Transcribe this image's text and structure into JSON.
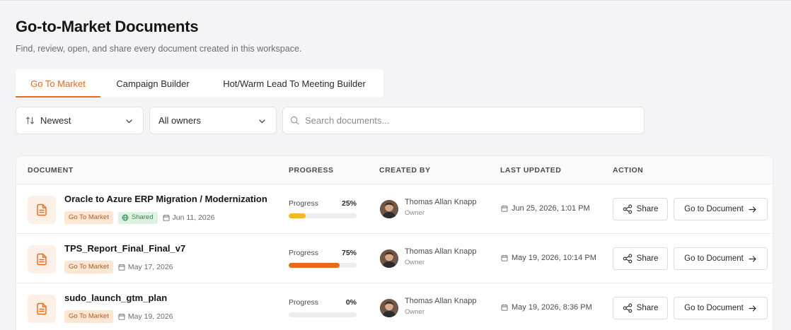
{
  "header": {
    "title": "Go-to-Market Documents",
    "subtitle": "Find, review, open, and share every document created in this workspace."
  },
  "tabs": [
    {
      "label": "Go To Market",
      "active": true
    },
    {
      "label": "Campaign Builder",
      "active": false
    },
    {
      "label": "Hot/Warm Lead To Meeting Builder",
      "active": false
    }
  ],
  "filters": {
    "sort": {
      "icon": "sort-icon",
      "selected": "Newest"
    },
    "owner": {
      "selected": "All owners"
    },
    "search": {
      "placeholder": "Search documents...",
      "value": ""
    }
  },
  "table": {
    "columns": [
      "DOCUMENT",
      "PROGRESS",
      "CREATED BY",
      "LAST UPDATED",
      "ACTION"
    ],
    "progress_label": "Progress",
    "share_label": "Share",
    "goto_label": "Go to Document",
    "rows": [
      {
        "title": "Oracle to Azure ERP Migration / Modernization",
        "tag": "Go To Market",
        "shared": true,
        "shared_label": "Shared",
        "created": "Jun 11, 2026",
        "progress": 25,
        "progress_text": "25%",
        "progress_color": "#f5b820",
        "owner": "Thomas Allan Knapp",
        "role": "Owner",
        "updated": "Jun 25, 2026, 1:01 PM"
      },
      {
        "title": "TPS_Report_Final_Final_v7",
        "tag": "Go To Market",
        "shared": false,
        "created": "May 17, 2026",
        "progress": 75,
        "progress_text": "75%",
        "progress_color": "#ea6a1a",
        "owner": "Thomas Allan Knapp",
        "role": "Owner",
        "updated": "May 19, 2026, 10:14 PM"
      },
      {
        "title": "sudo_launch_gtm_plan",
        "tag": "Go To Market",
        "shared": false,
        "created": "May 19, 2026",
        "progress": 0,
        "progress_text": "0%",
        "progress_color": "#ea6a1a",
        "owner": "Thomas Allan Knapp",
        "role": "Owner",
        "updated": "May 19, 2026, 8:36 PM"
      }
    ]
  },
  "colors": {
    "accent": "#ea6a1a",
    "shared_green": "#2e8b4a"
  }
}
